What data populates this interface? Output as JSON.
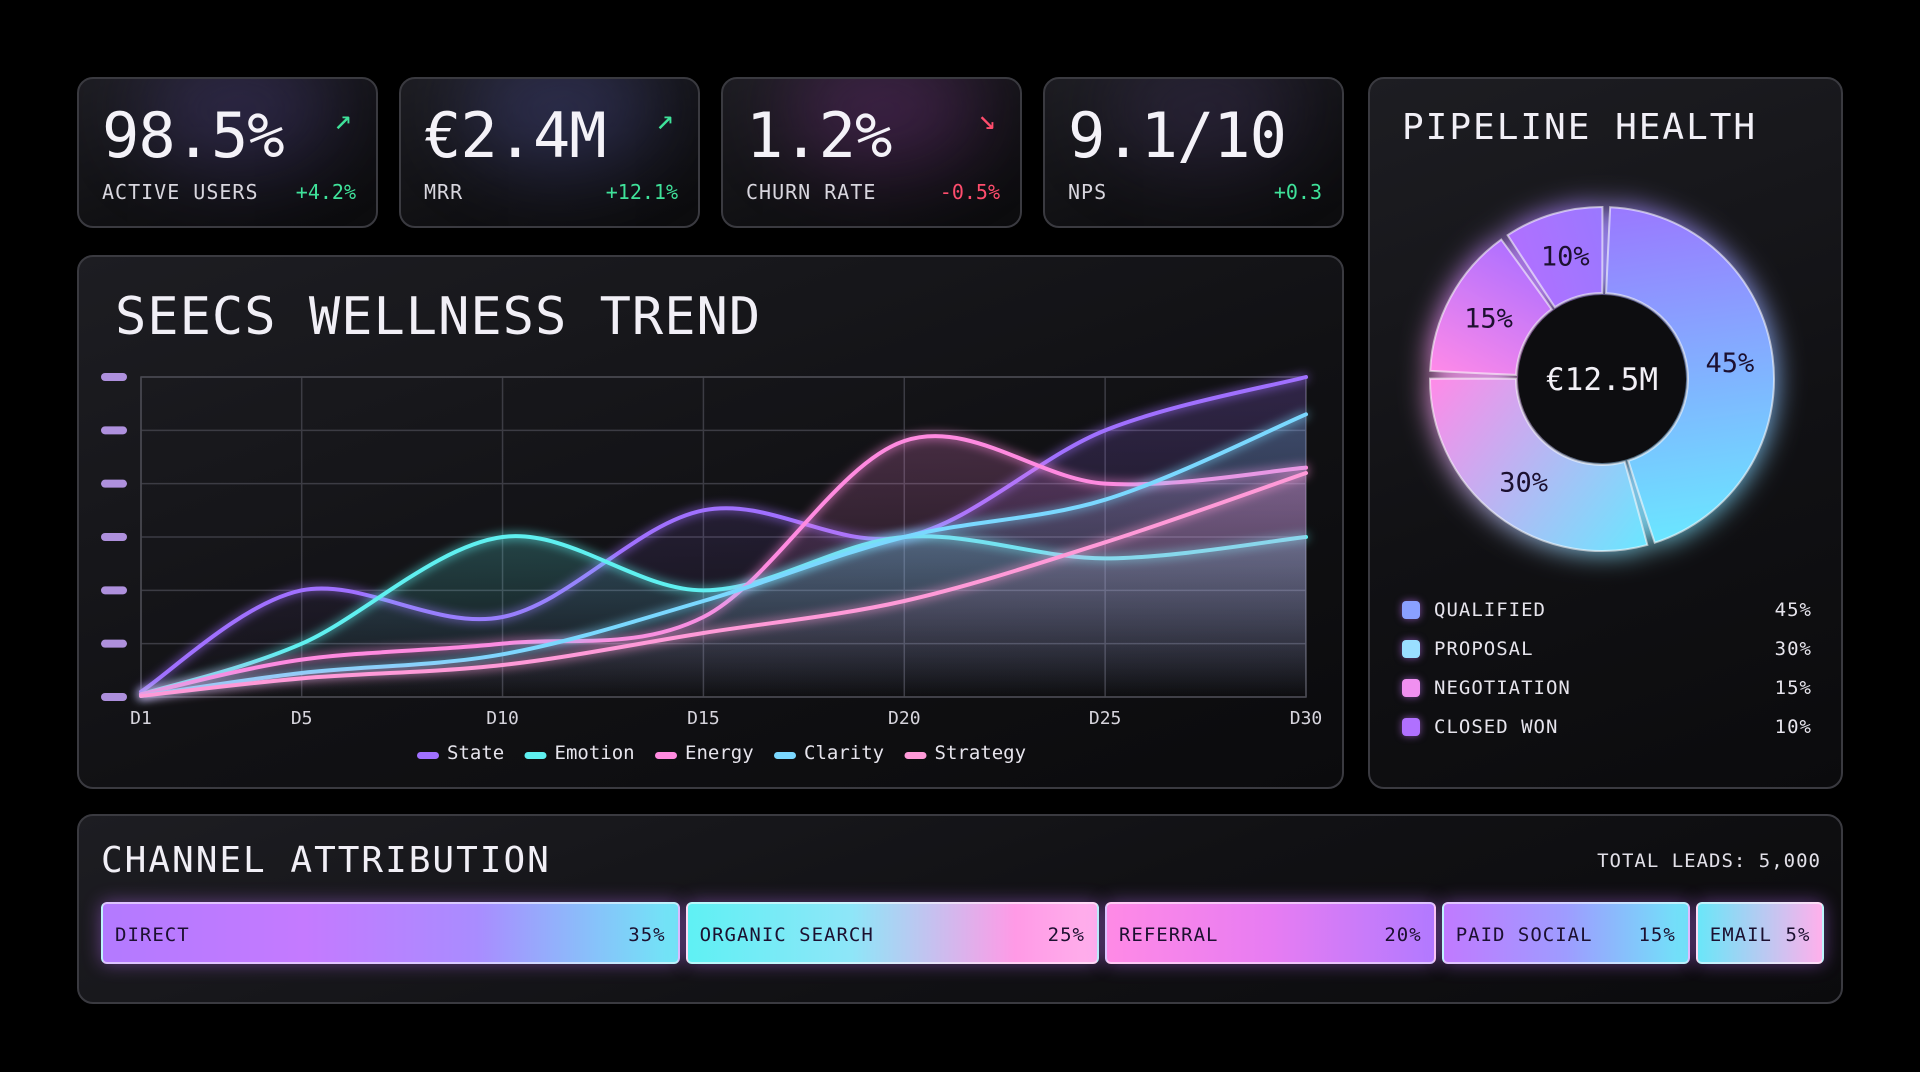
{
  "kpis": [
    {
      "value": "98.5%",
      "label": "ACTIVE USERS",
      "delta": "+4.2%",
      "trend": "up",
      "arrow": "↗",
      "glow": "#5a4a9a"
    },
    {
      "value": "€2.4M",
      "label": "MRR",
      "delta": "+12.1%",
      "trend": "up",
      "arrow": "↗",
      "glow": "#5a5cb0"
    },
    {
      "value": "1.2%",
      "label": "CHURN RATE",
      "delta": "-0.5%",
      "trend": "down",
      "arrow": "↘",
      "glow": "#8a3a9a"
    },
    {
      "value": "9.1/10",
      "label": "NPS",
      "delta": "+0.3",
      "trend": "up",
      "arrow": "",
      "glow": "#4a3a6a"
    }
  ],
  "trend": {
    "title": "SEECS WELLNESS TREND"
  },
  "chart_data": {
    "type": "line",
    "x": [
      1,
      5,
      10,
      15,
      20,
      25,
      30
    ],
    "x_tick_labels": [
      "D1",
      "D5",
      "D10",
      "D15",
      "D20",
      "D25",
      "D30"
    ],
    "ylim": [
      0,
      6
    ],
    "grid": true,
    "legend_position": "bottom",
    "series": [
      {
        "name": "State",
        "color": "#a070ff",
        "values": [
          0.1,
          2.0,
          1.5,
          3.5,
          3.0,
          5.0,
          6.0
        ]
      },
      {
        "name": "Emotion",
        "color": "#5ef0f0",
        "values": [
          0.05,
          1.0,
          3.0,
          2.0,
          3.0,
          2.6,
          3.0
        ]
      },
      {
        "name": "Energy",
        "color": "#ff8ae0",
        "values": [
          0.05,
          0.7,
          1.0,
          1.5,
          4.8,
          4.0,
          4.3
        ]
      },
      {
        "name": "Clarity",
        "color": "#7ad8ff",
        "values": [
          0.02,
          0.45,
          0.8,
          1.8,
          3.0,
          3.7,
          5.3
        ]
      },
      {
        "name": "Strategy",
        "color": "#ff9ad8",
        "values": [
          0.02,
          0.35,
          0.6,
          1.2,
          1.8,
          2.9,
          4.2
        ]
      }
    ]
  },
  "pipeline": {
    "title": "PIPELINE HEALTH",
    "center_value": "€12.5M",
    "segments": [
      {
        "label": "QUALIFIED",
        "pct_text": "45%",
        "value": 45,
        "color": "#9a78ff",
        "swatch": "#8aa0ff"
      },
      {
        "label": "PROPOSAL",
        "pct_text": "30%",
        "value": 30,
        "color": "#6ae6ff",
        "swatch": "#9adfff"
      },
      {
        "label": "NEGOTIATION",
        "pct_text": "15%",
        "value": 15,
        "color": "#ff8ae8",
        "swatch": "#f090f0"
      },
      {
        "label": "CLOSED WON",
        "pct_text": "10%",
        "value": 10,
        "color": "#b070ff",
        "swatch": "#b070ff"
      }
    ]
  },
  "channels": {
    "title": "CHANNEL ATTRIBUTION",
    "total": "TOTAL LEADS: 5,000",
    "segments": [
      {
        "label": "DIRECT",
        "pct_text": "35%",
        "value": 35,
        "gradient": "linear-gradient(90deg,#b37aff 0%,#c47aff 35%,#a98cff 65%,#6fe8f6 100%)"
      },
      {
        "label": "ORGANIC SEARCH",
        "pct_text": "25%",
        "value": 25,
        "gradient": "linear-gradient(90deg,#5ff0f4 0%,#8ee6f8 40%,#ff9ae6 80%,#ffb0ec 100%)"
      },
      {
        "label": "REFERRAL",
        "pct_text": "20%",
        "value": 20,
        "gradient": "linear-gradient(90deg,#ff8ae6 0%,#e77cf2 50%,#b27aff 100%)"
      },
      {
        "label": "PAID SOCIAL",
        "pct_text": "15%",
        "value": 15,
        "gradient": "linear-gradient(90deg,#c07aff 0%,#9e9cff 50%,#6ee6f8 100%)"
      },
      {
        "label": "EMAIL",
        "pct_text": "5%",
        "value": 5,
        "gradient": "linear-gradient(90deg,#6ae6f8 0%,#ffb0ec 100%)"
      }
    ]
  }
}
